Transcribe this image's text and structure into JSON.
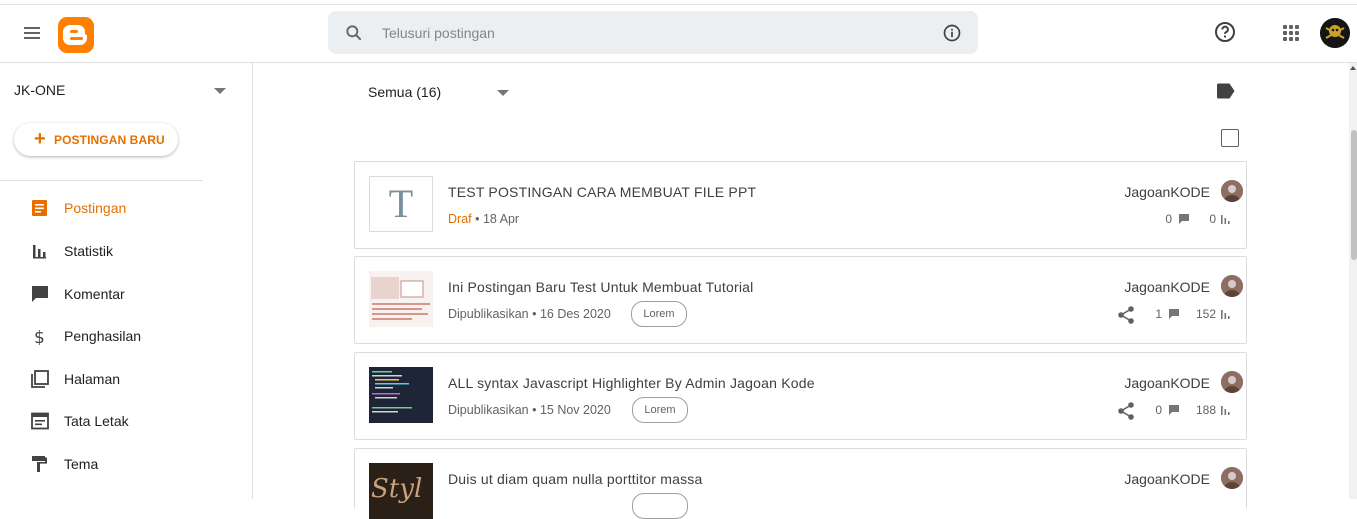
{
  "header": {
    "search_placeholder": "Telusuri postingan"
  },
  "sidebar": {
    "blog_name": "JK-ONE",
    "new_post_label": "POSTINGAN BARU",
    "items": [
      {
        "label": "Postingan",
        "icon": "posts-icon",
        "active": true
      },
      {
        "label": "Statistik",
        "icon": "stats-icon",
        "active": false
      },
      {
        "label": "Komentar",
        "icon": "comment-icon",
        "active": false
      },
      {
        "label": "Penghasilan",
        "icon": "dollar-icon",
        "active": false
      },
      {
        "label": "Halaman",
        "icon": "pages-icon",
        "active": false
      },
      {
        "label": "Tata Letak",
        "icon": "layout-icon",
        "active": false
      },
      {
        "label": "Tema",
        "icon": "theme-icon",
        "active": false
      }
    ]
  },
  "main": {
    "filter_label": "Semua (16)",
    "posts": [
      {
        "title": "TEST POSTINGAN CARA MEMBUAT FILE PPT",
        "status": "Draf",
        "date": "• 18 Apr",
        "label": "",
        "author": "JagoanKODE",
        "comments": "0",
        "views": "0"
      },
      {
        "title": "Ini Postingan Baru Test Untuk Membuat Tutorial",
        "status": "Dipublikasikan",
        "date": "• 16 Des 2020",
        "label": "Lorem",
        "author": "JagoanKODE",
        "comments": "1",
        "views": "152"
      },
      {
        "title": "ALL syntax Javascript Highlighter By Admin Jagoan Kode",
        "status": "Dipublikasikan",
        "date": "• 15 Nov 2020",
        "label": "Lorem",
        "author": "JagoanKODE",
        "comments": "0",
        "views": "188"
      },
      {
        "title": "Duis ut diam quam nulla porttitor massa",
        "status": "",
        "date": "",
        "label": "",
        "author": "JagoanKODE",
        "comments": "",
        "views": ""
      }
    ],
    "draft_thumb_letter": "T"
  },
  "colors": {
    "accent": "#e66f00",
    "blogger_orange": "#ff8000"
  }
}
